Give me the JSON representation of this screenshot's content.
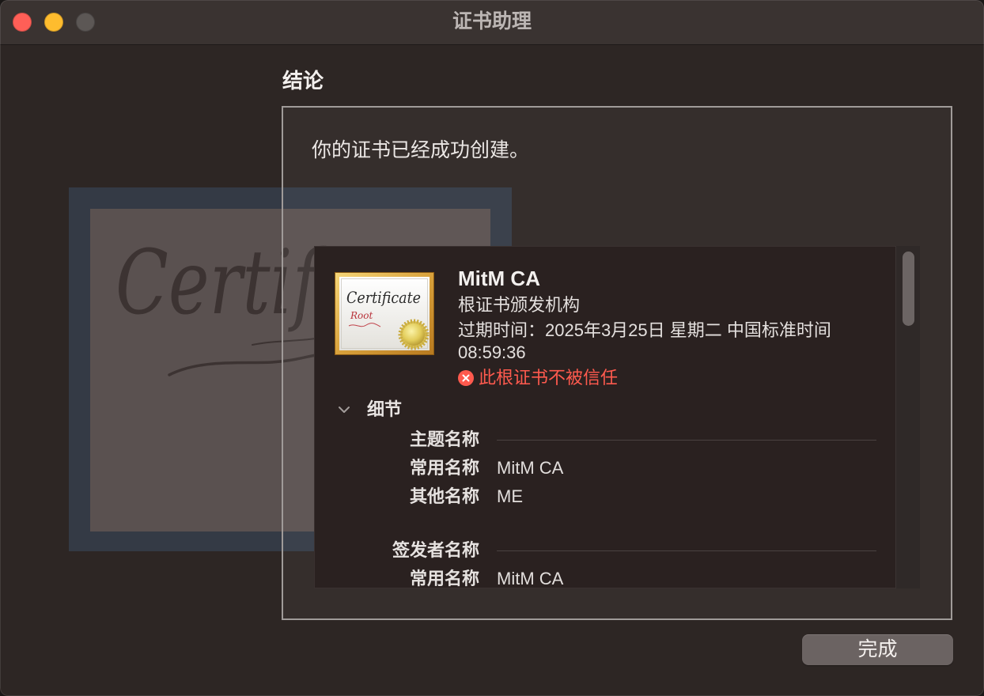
{
  "window": {
    "title": "证书助理"
  },
  "colors": {
    "window_background": "#2d2624",
    "title_bar_background": "#3a3331",
    "panel_background": "#2a2120",
    "close_button": "#ff5f57",
    "minimize_button": "#febc2e",
    "zoom_button_disabled": "#5c5755",
    "error_status": "#ff5a4e",
    "done_button_background": "#6b6362"
  },
  "page": {
    "heading": "结论",
    "message": "你的证书已经成功创建。"
  },
  "background_art": {
    "icon": "certificate-watermark",
    "script_text": "Certificate"
  },
  "certificate": {
    "icon": {
      "name": "certificate-root-icon",
      "script_text": "Certificate",
      "badge_text": "Root"
    },
    "name": "MitM CA",
    "kind": "根证书颁发机构",
    "expiry_date": "过期时间：2025年3月25日 星期二 中国标准时间",
    "expiry_time": "08:59:36",
    "trust_status": {
      "icon": "error-x-icon",
      "text": "此根证书不被信任",
      "trusted": false
    }
  },
  "details": {
    "toggle_icon": "chevron-down-icon",
    "expanded": true,
    "label": "细节",
    "sections": [
      {
        "title": "主题名称",
        "rows": [
          {
            "label": "常用名称",
            "value": "MitM CA"
          },
          {
            "label": "其他名称",
            "value": "ME"
          }
        ]
      },
      {
        "title": "签发者名称",
        "rows": [
          {
            "label": "常用名称",
            "value": "MitM CA"
          }
        ]
      }
    ]
  },
  "scrollbar": {
    "position": 0,
    "visible_fraction": 0.225
  },
  "footer": {
    "done_label": "完成"
  }
}
